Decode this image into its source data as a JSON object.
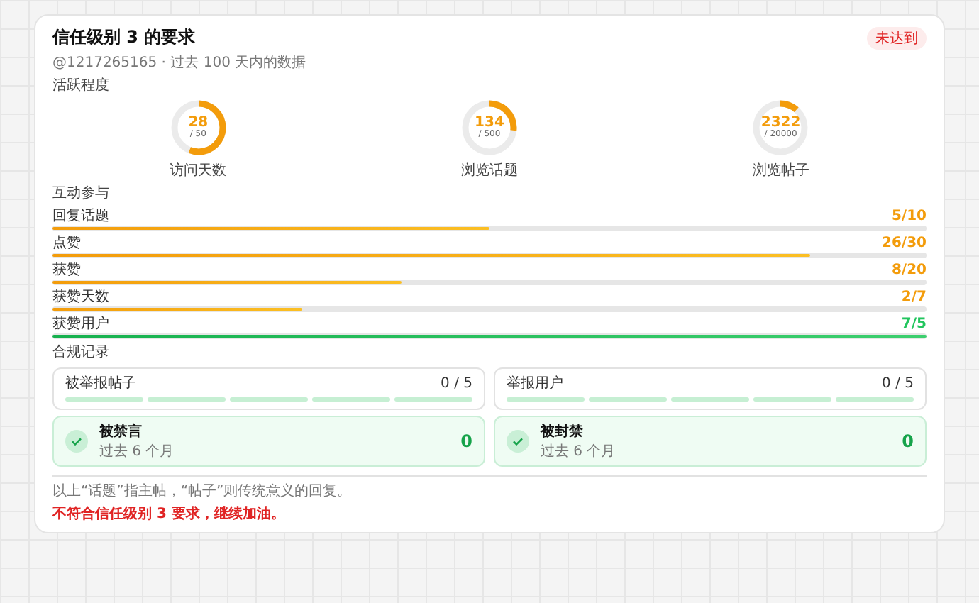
{
  "header": {
    "title": "信任级别 3 的要求",
    "badge": "未达到",
    "subtitle": "@1217265165 · 过去 100 天内的数据"
  },
  "activity": {
    "label": "活跃程度",
    "rings": [
      {
        "value": "28",
        "total": "/ 50",
        "caption": "访问天数",
        "level": 0.56
      },
      {
        "value": "134",
        "total": "/ 500",
        "caption": "浏览话题",
        "level": 0.268
      },
      {
        "value": "2322",
        "total": "/ 20000",
        "caption": "浏览帖子",
        "level": 0.116
      }
    ]
  },
  "interaction": {
    "label": "互动参与",
    "bars": [
      {
        "name": "回复话题",
        "reading": "5/10",
        "level": 0.5,
        "met": false
      },
      {
        "name": "点赞",
        "reading": "26/30",
        "level": 0.867,
        "met": false
      },
      {
        "name": "获赞",
        "reading": "8/20",
        "level": 0.4,
        "met": false
      },
      {
        "name": "获赞天数",
        "reading": "2/7",
        "level": 0.286,
        "met": false
      },
      {
        "name": "获赞用户",
        "reading": "7/5",
        "level": 1,
        "met": true
      }
    ]
  },
  "compliance": {
    "label": "合规记录",
    "reports": [
      {
        "name": "被举报帖子",
        "reading": "0 / 5"
      },
      {
        "name": "举报用户",
        "reading": "0 / 5"
      }
    ],
    "statuses": [
      {
        "name": "被禁言",
        "period": "过去 6 个月",
        "count": "0",
        "ok": true
      },
      {
        "name": "被封禁",
        "period": "过去 6 个月",
        "count": "0",
        "ok": true
      }
    ]
  },
  "footer": {
    "note": "以上“话题”指主帖，“帖子”则传统意义的回复。",
    "result": "不符合信任级别 3 要求，继续加油。"
  }
}
